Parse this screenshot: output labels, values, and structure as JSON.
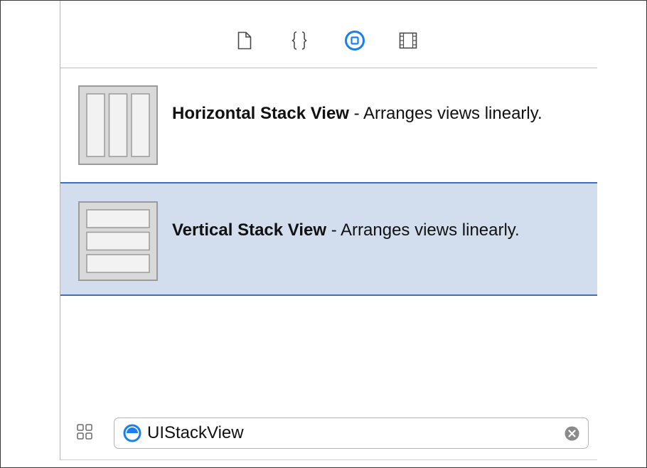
{
  "tabs": [
    {
      "icon": "file-icon",
      "selected": false
    },
    {
      "icon": "braces-icon",
      "selected": false
    },
    {
      "icon": "object-library-icon",
      "selected": true
    },
    {
      "icon": "media-library-icon",
      "selected": false
    }
  ],
  "items": [
    {
      "title": "Horizontal Stack View",
      "separator": " - ",
      "description": "Arranges views linearly.",
      "icon": "horizontal-stack-view-icon",
      "selected": false
    },
    {
      "title": "Vertical Stack View",
      "separator": " - ",
      "description": "Arranges views linearly.",
      "icon": "vertical-stack-view-icon",
      "selected": true
    }
  ],
  "search": {
    "value": "UIStackView",
    "scope_icon": "object-scope-icon",
    "clear_icon": "clear-search-icon"
  },
  "colors": {
    "accent": "#1a7ff0",
    "selection_bg": "#d2deed",
    "selection_border": "#3d6fbd"
  }
}
